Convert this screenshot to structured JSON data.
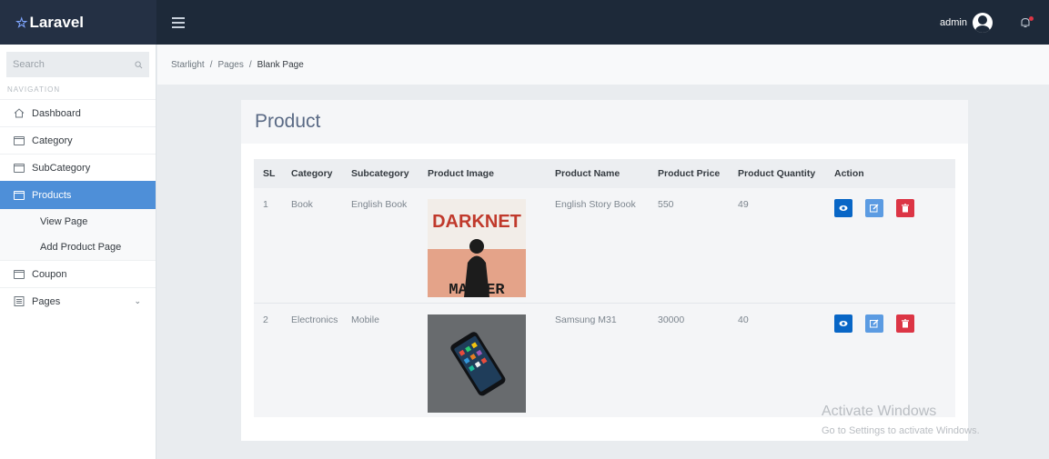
{
  "header": {
    "brand": "Laravel",
    "admin_name": "admin"
  },
  "sidebar": {
    "search_placeholder": "Search",
    "nav_label": "NAVIGATION",
    "items": [
      {
        "label": "Dashboard",
        "icon": "home-icon"
      },
      {
        "label": "Category",
        "icon": "window-icon"
      },
      {
        "label": "SubCategory",
        "icon": "window-icon"
      },
      {
        "label": "Products",
        "icon": "window-icon",
        "active": true
      },
      {
        "label": "Coupon",
        "icon": "window-icon"
      },
      {
        "label": "Pages",
        "icon": "list-icon"
      }
    ],
    "products_sub": [
      "View Page",
      "Add Product Page"
    ]
  },
  "breadcrumb": [
    "Starlight",
    "Pages",
    "Blank Page"
  ],
  "card": {
    "title": "Product"
  },
  "table": {
    "headers": [
      "SL",
      "Category",
      "Subcategory",
      "Product Image",
      "Product Name",
      "Product Price",
      "Product Quantity",
      "Action"
    ],
    "rows": [
      {
        "sl": "1",
        "category": "Book",
        "subcategory": "English Book",
        "image_title": "DARKNET",
        "image_author": "MATHER",
        "name": "English Story Book",
        "price": "550",
        "quantity": "49"
      },
      {
        "sl": "2",
        "category": "Electronics",
        "subcategory": "Mobile",
        "name": "Samsung M31",
        "price": "30000",
        "quantity": "40"
      }
    ]
  },
  "watermark": {
    "line1": "Activate Windows",
    "line2": "Go to Settings to activate Windows."
  },
  "colors": {
    "topbar": "#1d2939",
    "active_nav": "#4e8fd8",
    "view_button": "#0866c6",
    "edit_button": "#5b9be2",
    "delete_button": "#dc3545"
  }
}
